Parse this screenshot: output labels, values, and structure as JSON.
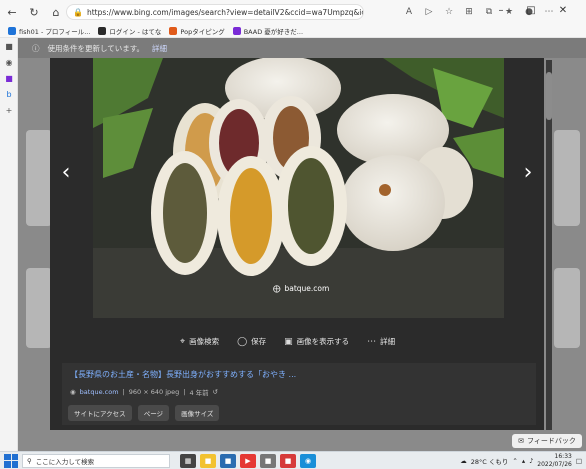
{
  "browser": {
    "url": "https://www.bing.com/images/search?view=detailV2&ccid=wa7Umpzq&id=484220C00CA3661...",
    "favorites": [
      {
        "label": "fish01 - プロフィール...",
        "color": "#1e73d8"
      },
      {
        "label": "ログイン - はてな",
        "color": "#2a2a2a"
      },
      {
        "label": "Popタイピング",
        "color": "#e05a1a"
      },
      {
        "label": "BAAD 憂が好きだ...",
        "color": "#7a2bd6"
      }
    ],
    "icons": [
      "back-icon",
      "refresh-icon",
      "home-icon",
      "lock-icon",
      "reader-icon",
      "zoom-icon",
      "favorite-icon",
      "extensions-icon",
      "collections-icon",
      "favorites-bar-icon",
      "profile-icon",
      "more-icon"
    ]
  },
  "page": {
    "notice_text": "使用条件を更新しています。",
    "notice_link": "詳細"
  },
  "viewer": {
    "watermark": "batque.com",
    "actions": [
      {
        "icon": "visual-search-icon",
        "label": "画像検索"
      },
      {
        "icon": "save-icon",
        "label": "保存"
      },
      {
        "icon": "view-image-icon",
        "label": "画像を表示する"
      },
      {
        "icon": "more-icon",
        "label": "詳細"
      }
    ],
    "title": "【長野県のお土産・名物】長野出身がおすすめする「おやき ...",
    "source": "batque.com",
    "dims": "960 × 640 jpeg",
    "age": "4 年前",
    "chips": [
      "サイトにアクセス",
      "ページ",
      "画像サイズ"
    ]
  },
  "feedback": "フィードバック",
  "taskbar": {
    "search_placeholder": "ここに入力して検索",
    "weather": "28°C くもり",
    "time": "16:33",
    "date": "2022/07/26"
  }
}
